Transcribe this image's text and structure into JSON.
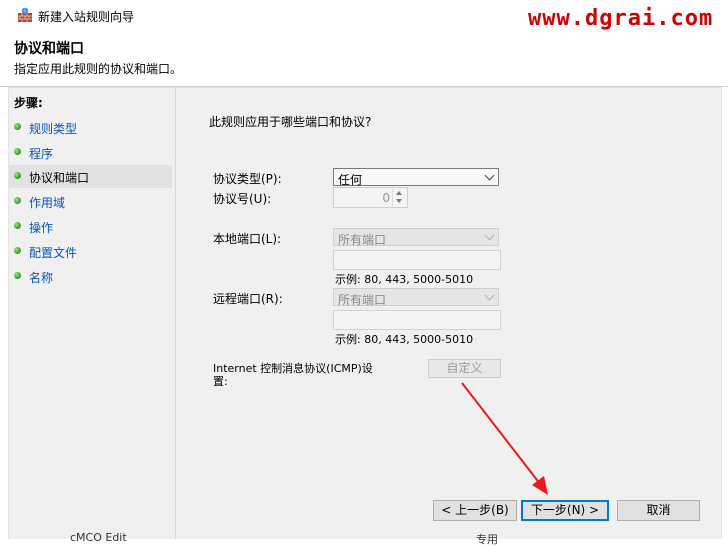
{
  "window": {
    "title": "新建入站规则向导",
    "watermark": "www.dgrai.com"
  },
  "header": {
    "title": "协议和端口",
    "subtitle": "指定应用此规则的协议和端口。"
  },
  "sidebar": {
    "title": "步骤:",
    "items": [
      {
        "label": "规则类型"
      },
      {
        "label": "程序"
      },
      {
        "label": "协议和端口"
      },
      {
        "label": "作用域"
      },
      {
        "label": "操作"
      },
      {
        "label": "配置文件"
      },
      {
        "label": "名称"
      }
    ],
    "active_index": 2
  },
  "main": {
    "question": "此规则应用于哪些端口和协议?",
    "protocol_type_label": "协议类型(P):",
    "protocol_type_value": "任何",
    "protocol_number_label": "协议号(U):",
    "protocol_number_value": "0",
    "local_port_label": "本地端口(L):",
    "local_port_value": "所有端口",
    "local_example": "示例: 80, 443, 5000-5010",
    "remote_port_label": "远程端口(R):",
    "remote_port_value": "所有端口",
    "remote_example": "示例: 80, 443, 5000-5010",
    "icmp_label_line1": "Internet 控制消息协议(ICMP)设",
    "icmp_label_line2": "置:",
    "customize_button": "自定义"
  },
  "footer": {
    "back_button": "< 上一步(B)",
    "next_button": "下一步(N) >",
    "cancel_button": "取消"
  },
  "background_strip": {
    "left_text": "cMCO Edit",
    "right_text": "专用"
  },
  "colors": {
    "watermark": "#d40000",
    "annotation_arrow": "#e81b1b",
    "link": "#0a56b8"
  }
}
